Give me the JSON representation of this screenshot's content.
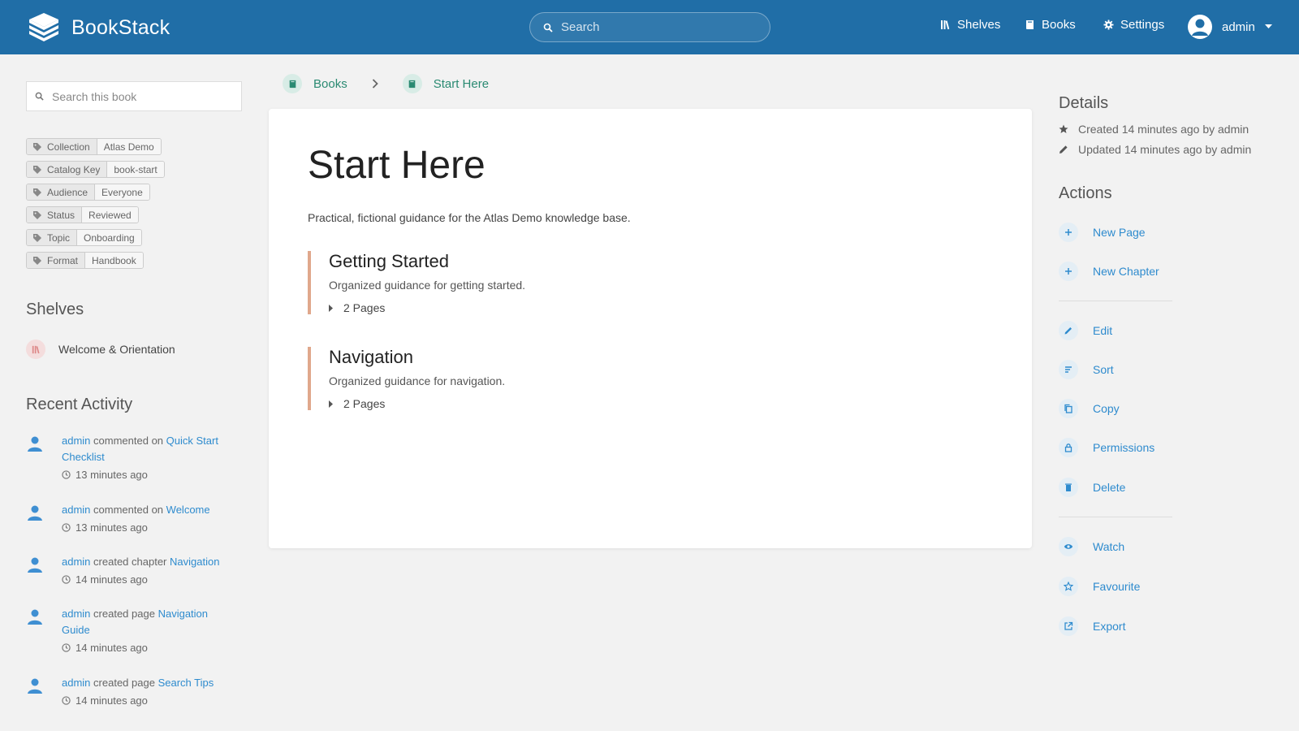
{
  "header": {
    "app_name": "BookStack",
    "search_placeholder": "Search",
    "nav": {
      "shelves": "Shelves",
      "books": "Books",
      "settings": "Settings"
    },
    "user_name": "admin"
  },
  "sidebar": {
    "search_placeholder": "Search this book",
    "tags": [
      {
        "name": "Collection",
        "value": "Atlas Demo"
      },
      {
        "name": "Catalog Key",
        "value": "book-start"
      },
      {
        "name": "Audience",
        "value": "Everyone"
      },
      {
        "name": "Status",
        "value": "Reviewed"
      },
      {
        "name": "Topic",
        "value": "Onboarding"
      },
      {
        "name": "Format",
        "value": "Handbook"
      }
    ],
    "shelves_heading": "Shelves",
    "shelves": [
      {
        "name": "Welcome & Orientation"
      }
    ],
    "activity_heading": "Recent Activity",
    "activity": [
      {
        "user": "admin",
        "action": "commented on",
        "target": "Quick Start Checklist",
        "time": "13 minutes ago"
      },
      {
        "user": "admin",
        "action": "commented on",
        "target": "Welcome",
        "time": "13 minutes ago"
      },
      {
        "user": "admin",
        "action": "created chapter",
        "target": "Navigation",
        "time": "14 minutes ago"
      },
      {
        "user": "admin",
        "action": "created page",
        "target": "Navigation Guide",
        "time": "14 minutes ago"
      },
      {
        "user": "admin",
        "action": "created page",
        "target": "Search Tips",
        "time": "14 minutes ago"
      }
    ]
  },
  "breadcrumb": {
    "books": "Books",
    "current": "Start Here"
  },
  "book": {
    "title": "Start Here",
    "description": "Practical, fictional guidance for the Atlas Demo knowledge base.",
    "chapters": [
      {
        "title": "Getting Started",
        "description": "Organized guidance for getting started.",
        "pages": "2 Pages"
      },
      {
        "title": "Navigation",
        "description": "Organized guidance for navigation.",
        "pages": "2 Pages"
      }
    ]
  },
  "details": {
    "heading": "Details",
    "created": "Created 14 minutes ago by admin",
    "updated": "Updated 14 minutes ago by admin"
  },
  "actions": {
    "heading": "Actions",
    "new_page": "New Page",
    "new_chapter": "New Chapter",
    "edit": "Edit",
    "sort": "Sort",
    "copy": "Copy",
    "permissions": "Permissions",
    "delete": "Delete",
    "watch": "Watch",
    "favourite": "Favourite",
    "export": "Export"
  },
  "colors": {
    "header": "#206ea7",
    "link": "#2e8bce",
    "book": "#2a8a72",
    "chapter_border": "#e0a88c"
  }
}
